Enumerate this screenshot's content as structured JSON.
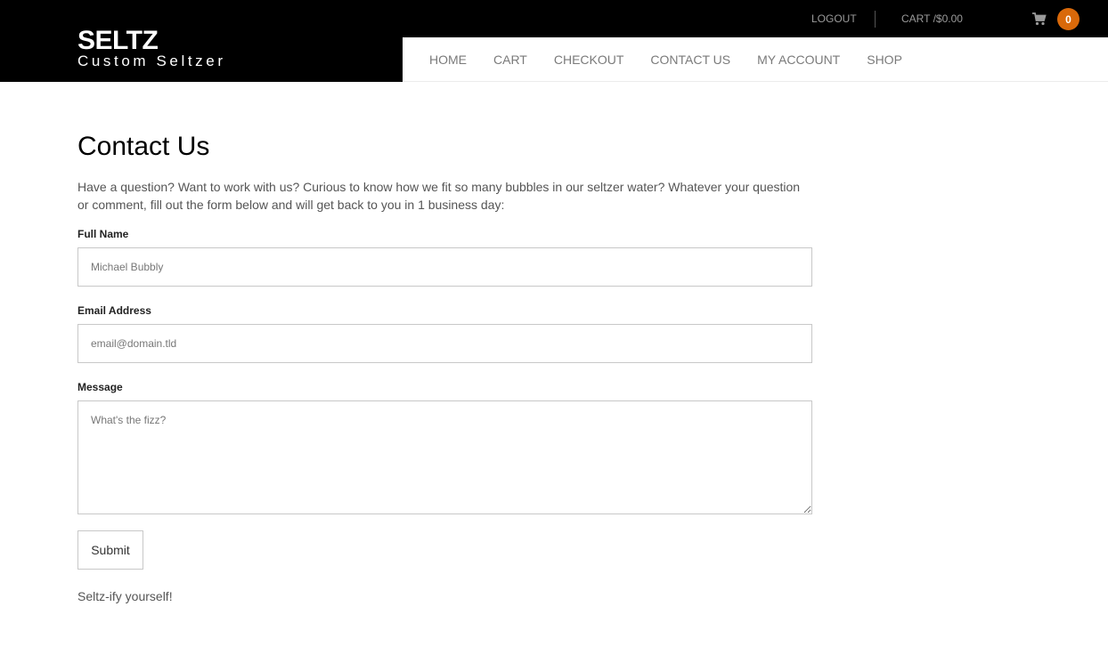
{
  "brand": {
    "name": "SELTZ",
    "tagline": "Custom Seltzer"
  },
  "topbar": {
    "logout_label": "LOGOUT",
    "cart_label": "CART /$0.00",
    "cart_icon": "shopping-cart-icon",
    "cart_count": "0",
    "badge_color": "#d9690a"
  },
  "nav": {
    "items": [
      {
        "label": "HOME"
      },
      {
        "label": "CART"
      },
      {
        "label": "CHECKOUT"
      },
      {
        "label": "CONTACT US"
      },
      {
        "label": "MY ACCOUNT"
      },
      {
        "label": "SHOP"
      }
    ]
  },
  "page": {
    "title": "Contact Us",
    "intro": "Have a question? Want to work with us? Curious to know how we fit so many bubbles in our seltzer water? Whatever your question or comment, fill out the form below and will get back to you in 1 business day:",
    "form": {
      "full_name_label": "Full Name",
      "full_name_placeholder": "Michael Bubbly",
      "email_label": "Email Address",
      "email_placeholder": "email@domain.tld",
      "message_label": "Message",
      "message_placeholder": "What's the fizz?",
      "submit_label": "Submit"
    },
    "footer_note": "Seltz-ify yourself!"
  }
}
